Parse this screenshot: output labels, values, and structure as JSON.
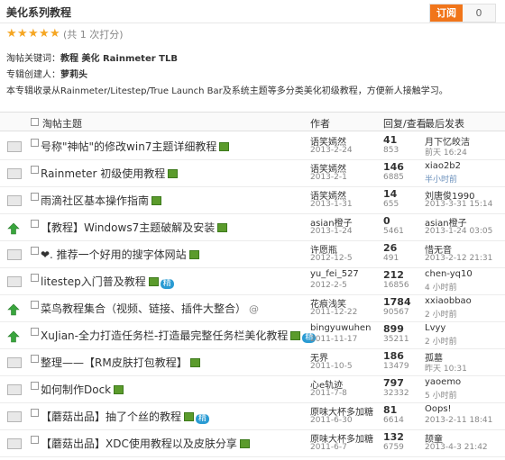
{
  "header": {
    "title": "美化系列教程",
    "subscribe_label": "订阅",
    "subscribe_count": "0"
  },
  "rating": {
    "stars": 5,
    "star_glyph": "★",
    "text": "(共 1 次打分)"
  },
  "meta": {
    "keywords_label": "淘帖关键词：",
    "keywords": "教程  美化  Rainmeter  TLB",
    "creator_label": "专辑创建人：",
    "creator": "萝莉头",
    "description": "本专辑收录从Rainmeter/Litestep/True Launch Bar及系统主题等多分类美化初级教程，方便新人接触学习。"
  },
  "columns": {
    "topic": "淘帖主题",
    "author": "作者",
    "stats": "回复/查看",
    "last": "最后发表"
  },
  "threads": [
    {
      "icon": "doc",
      "title": "号称\"神帖\"的修改win7主题详细教程",
      "img": true,
      "attach": false,
      "badge": "",
      "author": "语笑嫣然",
      "date": "2013-2-24",
      "replies": "41",
      "views": "853",
      "last_author": "月下忆皎洁",
      "last_time": "前天 16:24",
      "last_time_blue": false
    },
    {
      "icon": "doc",
      "title": "Rainmeter 初级使用教程",
      "img": true,
      "attach": false,
      "badge": "",
      "author": "语笑嫣然",
      "date": "2013-2-1",
      "replies": "146",
      "views": "6885",
      "last_author": "xiao2b2",
      "last_time": "半小时前",
      "last_time_blue": true
    },
    {
      "icon": "doc",
      "title": "雨滴社区基本操作指南",
      "img": true,
      "attach": false,
      "badge": "",
      "author": "语笑嫣然",
      "date": "2013-1-31",
      "replies": "14",
      "views": "655",
      "last_author": "刘唐俊1990",
      "last_time": "2013-3-31 15:14",
      "last_time_blue": false
    },
    {
      "icon": "up",
      "title": "【教程】Windows7主题破解及安装",
      "img": true,
      "attach": false,
      "badge": "",
      "author": "asian橙子",
      "date": "2013-1-24",
      "replies": "0",
      "views": "5461",
      "last_author": "asian橙子",
      "last_time": "2013-1-24 03:05",
      "last_time_blue": false
    },
    {
      "icon": "doc",
      "title": "❤. 推荐一个好用的搜字体网站",
      "img": true,
      "attach": false,
      "badge": "",
      "author": "许愿瓶",
      "date": "2012-12-5",
      "replies": "26",
      "views": "491",
      "last_author": "惜无音",
      "last_time": "2013-2-12 21:31",
      "last_time_blue": false
    },
    {
      "icon": "doc",
      "title": "litestep入门普及教程",
      "img": true,
      "attach": false,
      "badge": "精",
      "author": "yu_fei_527",
      "date": "2012-2-5",
      "replies": "212",
      "views": "16856",
      "last_author": "chen-yq10",
      "last_time": "4 小时前",
      "last_time_blue": false
    },
    {
      "icon": "up",
      "title": "菜鸟教程集合（视频、链接、插件大整合）",
      "img": false,
      "attach": true,
      "badge": "",
      "author": "花痕浅笑",
      "date": "2011-12-22",
      "replies": "1784",
      "views": "90567",
      "last_author": "xxiaobbao",
      "last_time": "2 小时前",
      "last_time_blue": false
    },
    {
      "icon": "up",
      "title": "XuJian-全力打造任务栏-打造最完整任务栏美化教程",
      "img": true,
      "attach": false,
      "badge": "精",
      "author": "bingyuwuhen",
      "date": "2011-11-17",
      "replies": "899",
      "views": "35211",
      "last_author": "Lvyy",
      "last_time": "2 小时前",
      "last_time_blue": false
    },
    {
      "icon": "doc",
      "title": "整理——【RM皮肤打包教程】",
      "img": true,
      "attach": false,
      "badge": "",
      "author": "无界",
      "date": "2011-10-5",
      "replies": "186",
      "views": "13479",
      "last_author": "孤墓",
      "last_time": "昨天 10:31",
      "last_time_blue": false
    },
    {
      "icon": "doc",
      "title": "如何制作Dock",
      "img": true,
      "attach": false,
      "badge": "",
      "author": "心e轨迹",
      "date": "2011-7-8",
      "replies": "797",
      "views": "32332",
      "last_author": "yaoemo",
      "last_time": "5 小时前",
      "last_time_blue": false
    },
    {
      "icon": "doc",
      "title": "【蘑菇出品】抽了个丝的教程",
      "img": true,
      "attach": false,
      "badge": "精",
      "author": "原味大杯多加糖",
      "date": "2011-6-30",
      "replies": "81",
      "views": "6614",
      "last_author": "Oops!",
      "last_time": "2013-2-11 18:41",
      "last_time_blue": false
    },
    {
      "icon": "doc",
      "title": "【蘑菇出品】XDC使用教程以及皮肤分享",
      "img": true,
      "attach": false,
      "badge": "",
      "author": "原味大杯多加糖",
      "date": "2011-6-7",
      "replies": "132",
      "views": "6759",
      "last_author": "颉童",
      "last_time": "2013-4-3 21:42",
      "last_time_blue": false
    }
  ]
}
